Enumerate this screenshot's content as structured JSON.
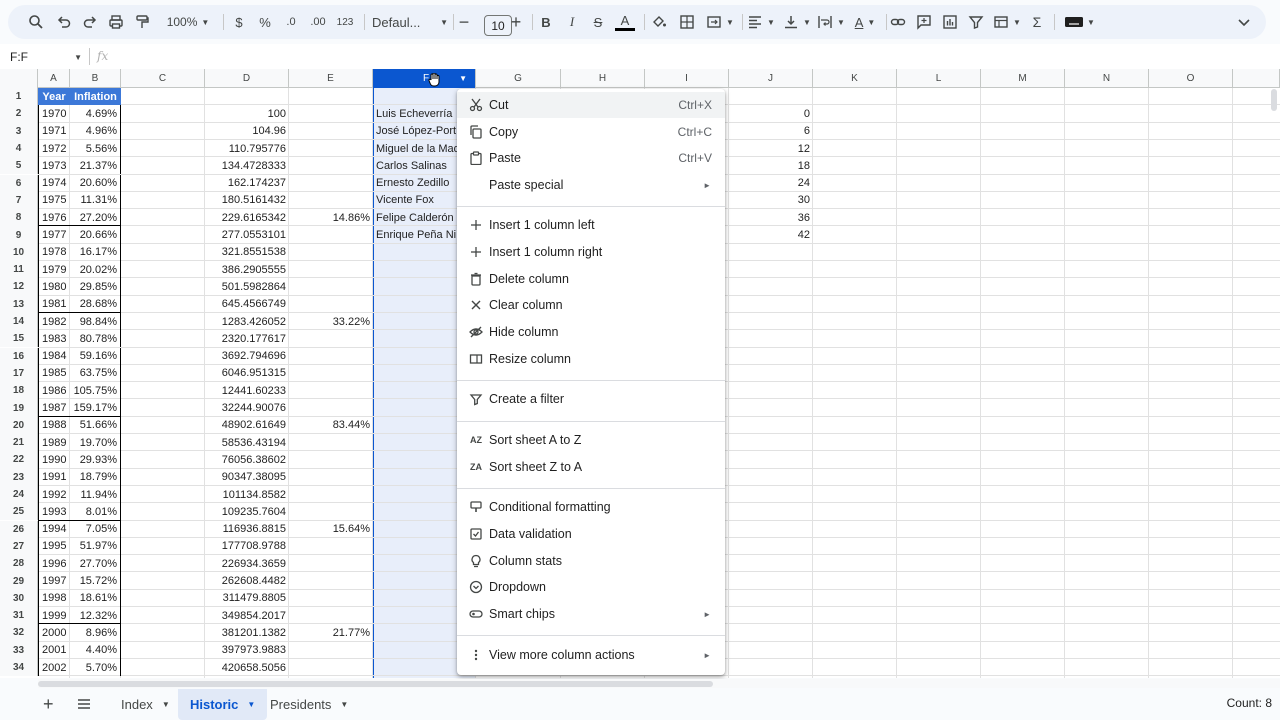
{
  "toolbar": {
    "zoom": "100%",
    "currency": "$",
    "percent": "%",
    "decrease_decimal": ".0",
    "increase_decimal": ".00",
    "more_formats": "123",
    "font": "Defaul...",
    "font_size": "10",
    "bold": "B",
    "italic": "I",
    "strikethrough": "S",
    "text_color": "A"
  },
  "formula_bar": {
    "name_box": "F:F",
    "fx": "fx"
  },
  "columns": [
    "A",
    "B",
    "C",
    "D",
    "E",
    "F",
    "G",
    "H",
    "I",
    "J",
    "K",
    "L",
    "M",
    "N",
    "O"
  ],
  "selected_column": "F",
  "rows": [
    "1",
    "2",
    "3",
    "4",
    "5",
    "6",
    "7",
    "8",
    "9",
    "10",
    "11",
    "12",
    "13",
    "14",
    "15",
    "16",
    "17",
    "18",
    "19",
    "20",
    "21",
    "22",
    "23",
    "24",
    "25",
    "26",
    "27",
    "28",
    "29",
    "30",
    "31",
    "32",
    "33",
    "34"
  ],
  "header": {
    "year": "Year",
    "inflation": "Inflation"
  },
  "col_a": [
    "1970",
    "1971",
    "1972",
    "1973",
    "1974",
    "1975",
    "1976",
    "1977",
    "1978",
    "1979",
    "1980",
    "1981",
    "1982",
    "1983",
    "1984",
    "1985",
    "1986",
    "1987",
    "1988",
    "1989",
    "1990",
    "1991",
    "1992",
    "1993",
    "1994",
    "1995",
    "1996",
    "1997",
    "1998",
    "1999",
    "2000",
    "2001",
    "2002"
  ],
  "col_b": [
    "4.69%",
    "4.96%",
    "5.56%",
    "21.37%",
    "20.60%",
    "11.31%",
    "27.20%",
    "20.66%",
    "16.17%",
    "20.02%",
    "29.85%",
    "28.68%",
    "98.84%",
    "80.78%",
    "59.16%",
    "63.75%",
    "105.75%",
    "159.17%",
    "51.66%",
    "19.70%",
    "29.93%",
    "18.79%",
    "11.94%",
    "8.01%",
    "7.05%",
    "51.97%",
    "27.70%",
    "15.72%",
    "18.61%",
    "12.32%",
    "8.96%",
    "4.40%",
    "5.70%"
  ],
  "col_d": [
    "100",
    "104.96",
    "110.795776",
    "134.4728333",
    "162.174237",
    "180.5161432",
    "229.6165342",
    "277.0553101",
    "321.8551538",
    "386.2905555",
    "501.5982864",
    "645.4566749",
    "1283.426052",
    "2320.177617",
    "3692.794696",
    "6046.951315",
    "12441.60233",
    "32244.90076",
    "48902.61649",
    "58536.43194",
    "76056.38602",
    "90347.38095",
    "101134.8582",
    "109235.7604",
    "116936.8815",
    "177708.9788",
    "226934.3659",
    "262608.4482",
    "311479.8805",
    "349854.2017",
    "381201.1382",
    "397973.9883",
    "420658.5056"
  ],
  "col_e": [
    {
      "row": 8,
      "value": "14.86%"
    },
    {
      "row": 14,
      "value": "33.22%"
    },
    {
      "row": 20,
      "value": "83.44%"
    },
    {
      "row": 26,
      "value": "15.64%"
    },
    {
      "row": 32,
      "value": "21.77%"
    }
  ],
  "col_f": [
    "Luis Echeverría",
    "José López-Port",
    "Miguel de la Mad",
    "Carlos Salinas",
    "Ernesto Zedillo",
    "Vicente Fox",
    "Felipe Calderón",
    "Enrique Peña Ni"
  ],
  "col_j": [
    "0",
    "6",
    "12",
    "18",
    "24",
    "30",
    "36",
    "42"
  ],
  "context_menu": {
    "cut": {
      "label": "Cut",
      "shortcut": "Ctrl+X"
    },
    "copy": {
      "label": "Copy",
      "shortcut": "Ctrl+C"
    },
    "paste": {
      "label": "Paste",
      "shortcut": "Ctrl+V"
    },
    "paste_special": {
      "label": "Paste special"
    },
    "insert_left": {
      "label": "Insert 1 column left"
    },
    "insert_right": {
      "label": "Insert 1 column right"
    },
    "delete_column": {
      "label": "Delete column"
    },
    "clear_column": {
      "label": "Clear column"
    },
    "hide_column": {
      "label": "Hide column"
    },
    "resize_column": {
      "label": "Resize column"
    },
    "create_filter": {
      "label": "Create a filter"
    },
    "sort_az": {
      "label": "Sort sheet A to Z"
    },
    "sort_za": {
      "label": "Sort sheet Z to A"
    },
    "conditional_formatting": {
      "label": "Conditional formatting"
    },
    "data_validation": {
      "label": "Data validation"
    },
    "column_stats": {
      "label": "Column stats"
    },
    "dropdown": {
      "label": "Dropdown"
    },
    "smart_chips": {
      "label": "Smart chips"
    },
    "more_actions": {
      "label": "View more column actions"
    }
  },
  "sheets": {
    "tab1": "Index",
    "tab2": "Historic",
    "tab3": "Presidents",
    "active": "Historic"
  },
  "status": {
    "count": "Count: 8"
  },
  "colors": {
    "accent": "#0b57d0",
    "header_fill": "#3c78d8",
    "selection": "#e8eefa"
  }
}
